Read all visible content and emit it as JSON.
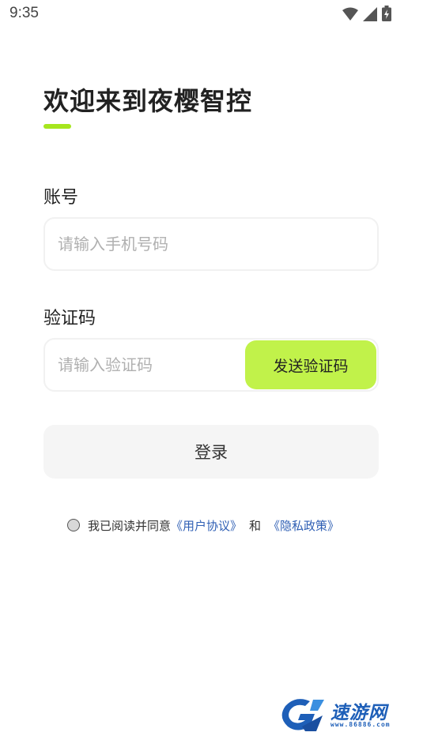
{
  "status_bar": {
    "time": "9:35",
    "icons": [
      "wifi-icon",
      "signal-icon",
      "battery-charging-icon"
    ]
  },
  "page": {
    "title": "欢迎来到夜樱智控",
    "accent_color": "#a6e61e"
  },
  "account": {
    "label": "账号",
    "placeholder": "请输入手机号码",
    "value": ""
  },
  "code": {
    "label": "验证码",
    "placeholder": "请输入验证码",
    "value": "",
    "send_button_label": "发送验证码",
    "send_button_color": "#c1f24a"
  },
  "login": {
    "label": "登录"
  },
  "agreement": {
    "checked": false,
    "prefix": "我已阅读并同意",
    "user_agreement_link": "《用户协议》",
    "conjunction": "和",
    "privacy_policy_link": "《隐私政策》",
    "link_color": "#2f5fb4"
  },
  "watermark": {
    "brand": "速游网",
    "url": "www.86886.com",
    "icon": "logo-icon"
  }
}
